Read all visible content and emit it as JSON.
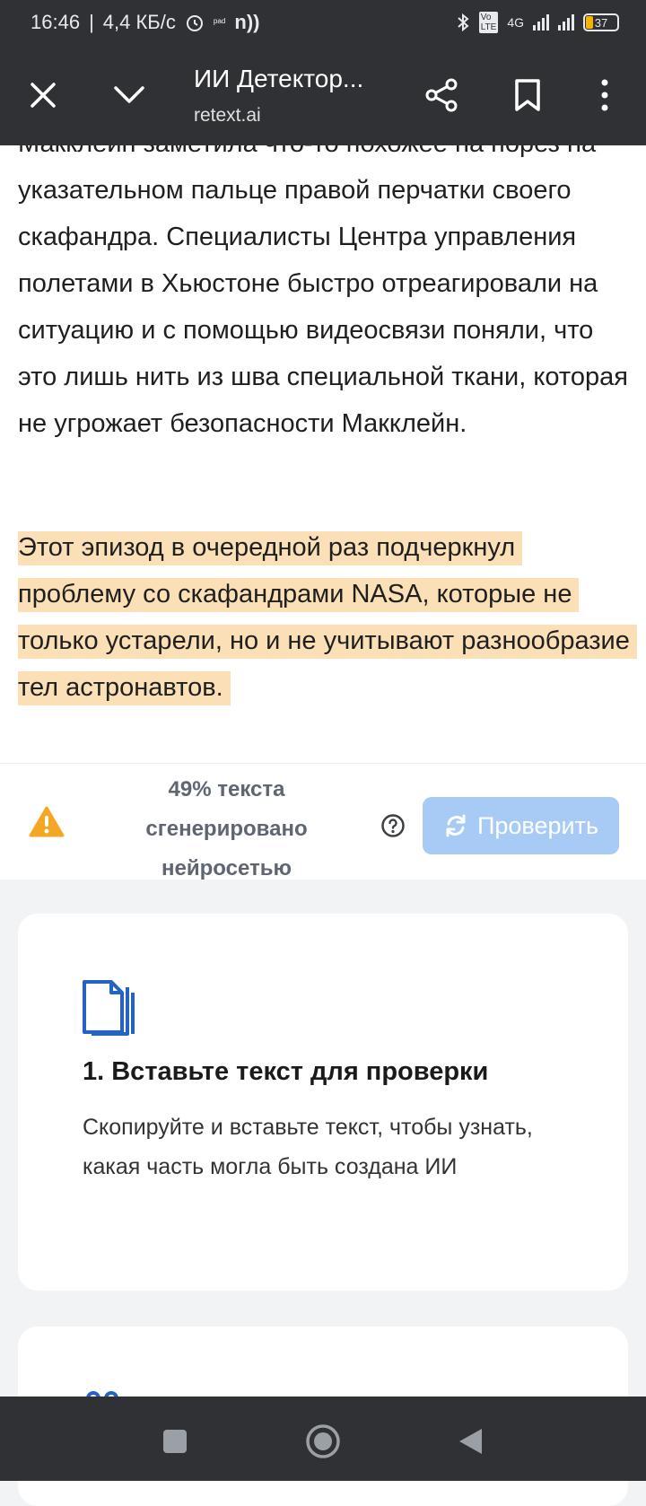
{
  "status_bar": {
    "time": "16:46",
    "speed": "4,4 КБ/с",
    "network": "4G",
    "battery": "37"
  },
  "browser": {
    "title": "ИИ Детектор...",
    "url": "retext.ai"
  },
  "article": {
    "paragraph1": "Макклейн заметила что-то похожее на порез на указательном пальце правой перчатки своего скафандра. Специалисты Центра управления полетами в Хьюстоне быстро отреагировали на ситуацию и с помощью видеосвязи поняли, что это лишь нить из шва специальной ткани, которая не угрожает безопасности Макклейн.",
    "paragraph2_highlighted": "Этот эпизод в очередной раз подчеркнул проблему со скафандрами NASA, которые не только устарели, но и не учитывают разнообразие тел астронавтов."
  },
  "ai_check": {
    "result_text": "49% текста сгенерировано нейросетью",
    "check_button_label": "Проверить",
    "warning_color": "#f5a623",
    "button_color": "#a8cbf5"
  },
  "steps": {
    "step1_title": "1. Вставьте текст для проверки",
    "step1_desc": "Скопируйте и вставьте текст, чтобы узнать, какая часть могла быть создана ИИ"
  },
  "colors": {
    "highlight": "#fbdfb6",
    "accent_blue": "#2563c0"
  }
}
